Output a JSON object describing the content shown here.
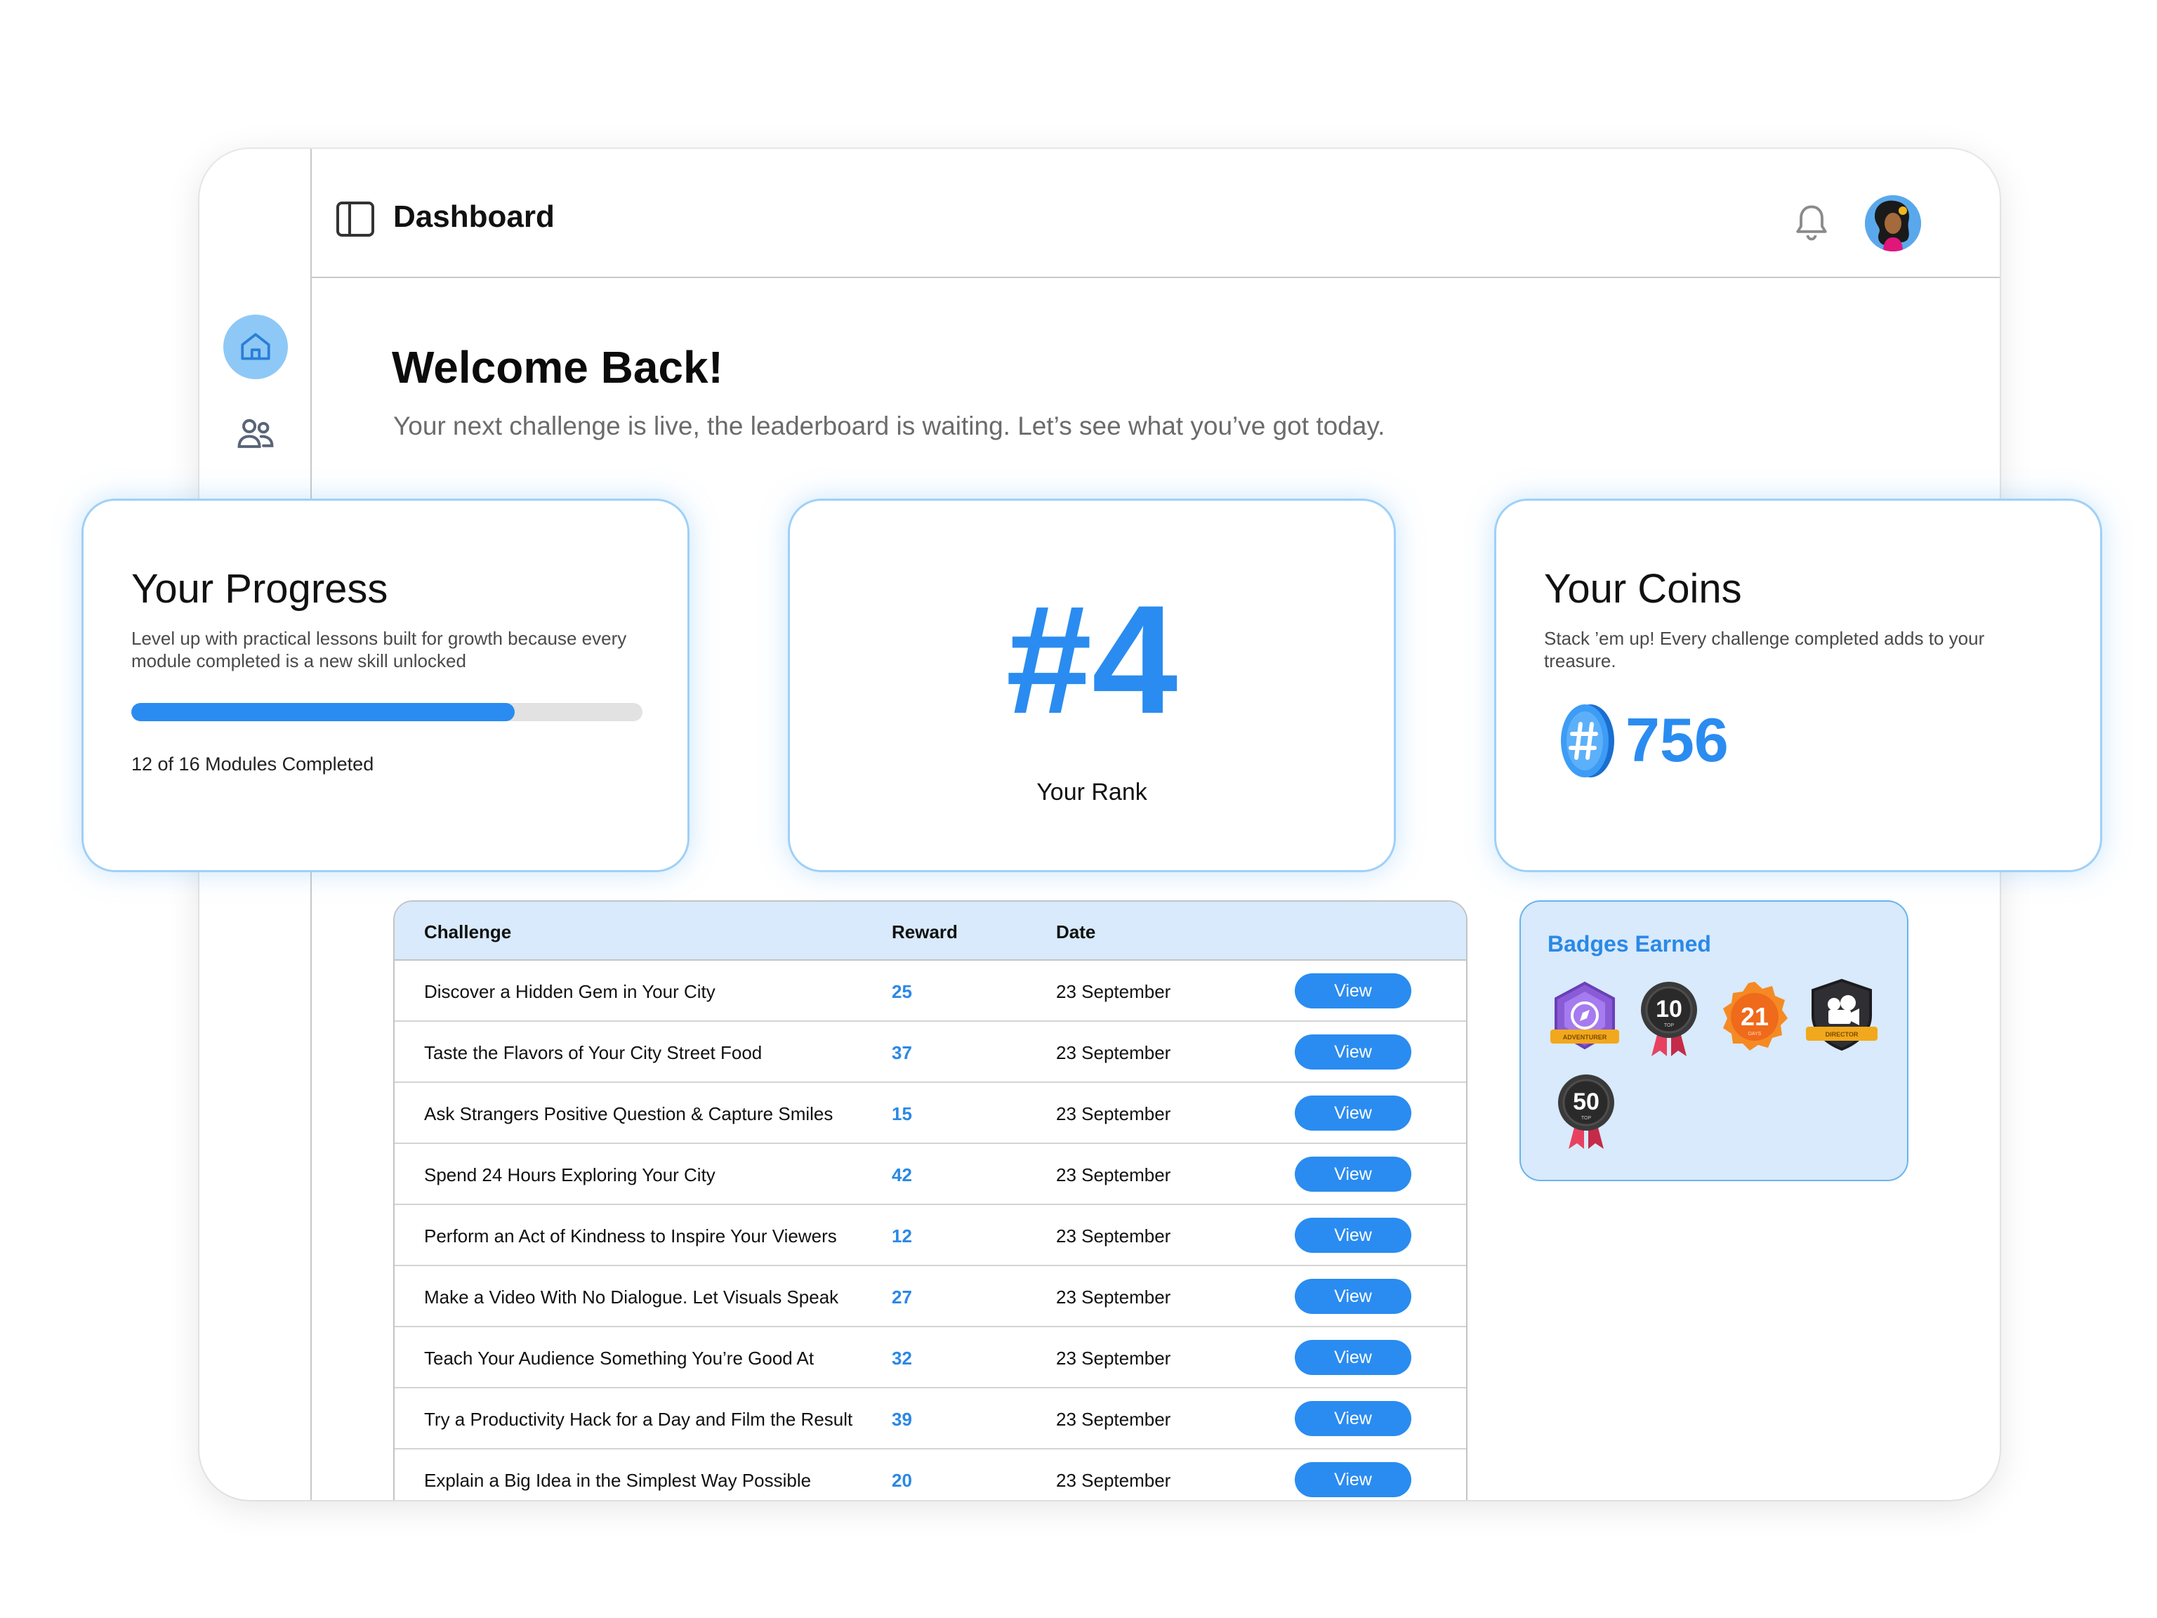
{
  "header": {
    "title": "Dashboard"
  },
  "welcome": {
    "title": "Welcome Back!",
    "subtitle": "Your next challenge is live, the leaderboard is waiting. Let’s see what you’ve got today."
  },
  "progress_card": {
    "title": "Your Progress",
    "description": "Level up with practical lessons built for growth because every module completed is a new skill unlocked",
    "completed": 12,
    "total": 16,
    "fraction": 0.75,
    "label": "12 of 16 Modules Completed"
  },
  "rank_card": {
    "value": "#4",
    "label": "Your Rank"
  },
  "coins_card": {
    "title": "Your Coins",
    "description": "Stack ’em up! Every challenge completed adds to your treasure.",
    "value": "756"
  },
  "table": {
    "headers": {
      "challenge": "Challenge",
      "reward": "Reward",
      "date": "Date"
    },
    "rows": [
      {
        "challenge": "Discover a Hidden Gem in Your City",
        "reward": "25",
        "date": "23 September",
        "action": "View"
      },
      {
        "challenge": "Taste the Flavors of Your City Street Food",
        "reward": "37",
        "date": "23 September",
        "action": "View"
      },
      {
        "challenge": "Ask Strangers Positive Question & Capture Smiles",
        "reward": "15",
        "date": "23 September",
        "action": "View"
      },
      {
        "challenge": "Spend 24 Hours Exploring Your City",
        "reward": "42",
        "date": "23 September",
        "action": "View"
      },
      {
        "challenge": "Perform an Act of Kindness to Inspire Your Viewers",
        "reward": "12",
        "date": "23 September",
        "action": "View"
      },
      {
        "challenge": "Make a Video With No Dialogue. Let Visuals Speak",
        "reward": "27",
        "date": "23 September",
        "action": "View"
      },
      {
        "challenge": "Teach Your Audience Something You’re Good At",
        "reward": "32",
        "date": "23 September",
        "action": "View"
      },
      {
        "challenge": "Try a Productivity Hack for a Day and Film the Result",
        "reward": "39",
        "date": "23 September",
        "action": "View"
      },
      {
        "challenge": "Explain a Big Idea in the Simplest Way Possible",
        "reward": "20",
        "date": "23 September",
        "action": "View"
      }
    ]
  },
  "badges": {
    "title": "Badges Earned",
    "items": [
      {
        "icon": "adventurer-badge",
        "number": "",
        "caption": "ADVENTURER"
      },
      {
        "icon": "top-10-badge",
        "number": "10",
        "caption": "TOP"
      },
      {
        "icon": "21-days-badge",
        "number": "21",
        "caption": "DAYS"
      },
      {
        "icon": "director-badge",
        "number": "",
        "caption": "DIRECTOR"
      },
      {
        "icon": "top-50-badge",
        "number": "50",
        "caption": "TOP"
      }
    ]
  },
  "colors": {
    "accent": "#2a8cf0",
    "accent_light": "#d8eafb",
    "card_border": "#9fd0f7",
    "text_muted": "#6b6b6b"
  },
  "icons": {
    "sidebar": [
      "home-icon",
      "users-icon",
      "document-icon"
    ],
    "topbar": [
      "sidebar-toggle-icon",
      "bell-icon"
    ]
  }
}
